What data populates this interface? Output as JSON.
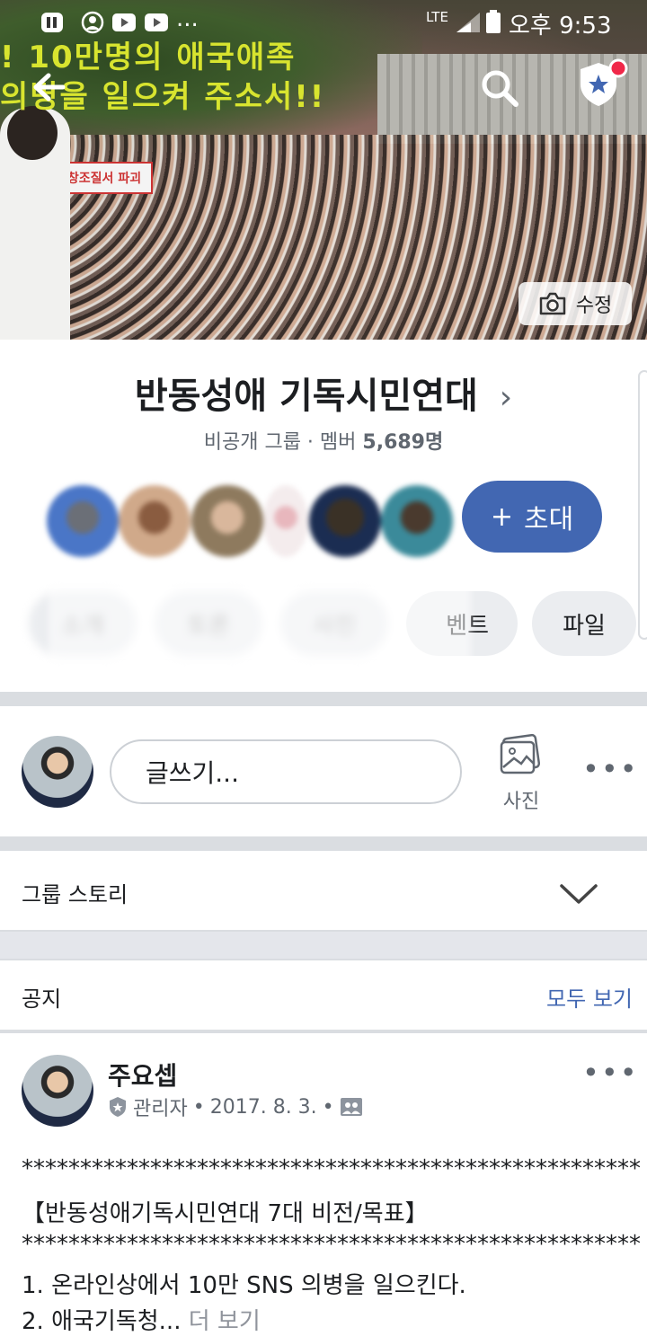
{
  "status_bar": {
    "network": "LTE",
    "time": "오후 9:53"
  },
  "cover": {
    "overlay_line1": "! 10만명의 애국애족",
    "overlay_line2": "의병을 일으켜 주소서!!",
    "banner_text": "창조질서 파괴",
    "edit_label": "수정",
    "edit_icon": "camera-icon"
  },
  "header": {
    "back_icon": "back-arrow-icon",
    "search_icon": "search-icon",
    "badge_icon": "shield-star-icon"
  },
  "group": {
    "name": "반동성애 기독시민연대",
    "chevron": "›",
    "privacy": "비공개 그룹 · 멤버",
    "member_count": "5,689명",
    "invite_label": "초대",
    "invite_plus": "+"
  },
  "tabs": [
    {
      "label": "소개"
    },
    {
      "label": "토론"
    },
    {
      "label": "사진"
    },
    {
      "label": "이벤트"
    },
    {
      "label": "파일"
    }
  ],
  "tab_visible_fragment": "벤트",
  "composer": {
    "placeholder": "글쓰기...",
    "photo_label": "사진"
  },
  "stories": {
    "label": "그룹 스토리"
  },
  "notice": {
    "label": "공지",
    "see_all": "모두 보기"
  },
  "post": {
    "author": "주요셉",
    "role": "관리자",
    "date": "2017. 8. 3.",
    "separator": "•",
    "stars": "*****************************************************",
    "title": "【반동성애기독시민연대 7대 비전/목표】",
    "line1": "1. 온라인상에서 10만 SNS 의병을 일으킨다.",
    "line2": "2. 애국기독청...",
    "more": "더 보기"
  },
  "colors": {
    "accent": "#4267b2",
    "divider": "#dadde1",
    "badge_red": "#f02849"
  }
}
